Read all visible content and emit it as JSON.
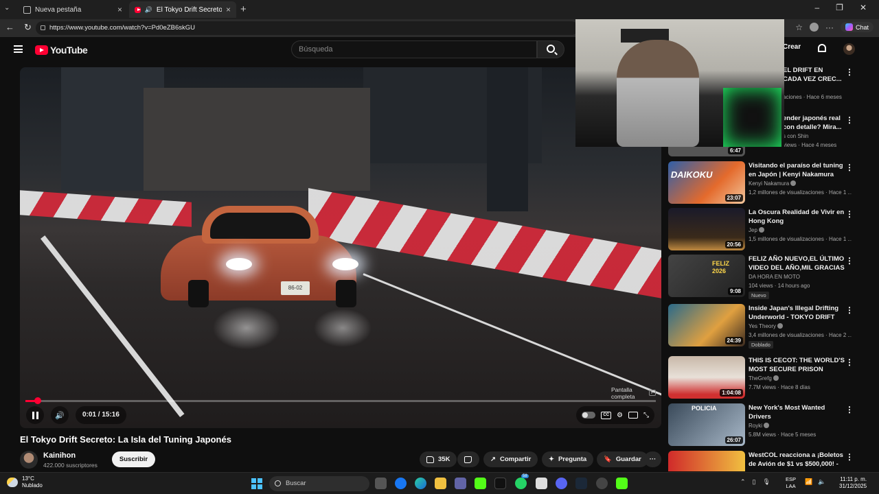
{
  "browser": {
    "tabs": [
      {
        "label": "Nueva pestaña"
      },
      {
        "label": "El Tokyo Drift Secreto: La Isla"
      }
    ],
    "url": "https://www.youtube.com/watch?v=Pd0eZB6skGU",
    "chat_label": "Chat"
  },
  "youtube": {
    "logo_text": "YouTube",
    "search_placeholder": "Búsqueda",
    "create_label": "Crear"
  },
  "player": {
    "time": "0:01 / 15:16",
    "progress_fraction": 0.0011,
    "tooltip_line1": "Pantalla",
    "tooltip_line2": "completa",
    "tooltip_key": "F",
    "plate": "86-02"
  },
  "video": {
    "title": "El Tokyo Drift Secreto: La Isla del Tuning Japonés",
    "channel": "Kainihon",
    "subscribers": "422.000 suscriptores",
    "subscribe_label": "Suscribir",
    "likes": "35K",
    "share_label": "Compartir",
    "ask_label": "Pregunta",
    "save_label": "Guardar"
  },
  "recommendations": [
    {
      "title_line1": "EL DRIFT EN",
      "title_line2": "CADA VEZ CREC...",
      "channel": "",
      "meta": "aciones · Hace 6 meses",
      "duration": "",
      "badge": ""
    },
    {
      "title_line1": "ender japonés real",
      "title_line2": "con detalle? Mira...",
      "channel": "s con Shin",
      "meta": "views · Hace 4 meses",
      "duration": "6:47",
      "badge": ""
    },
    {
      "title_line1": "Visitando el paraíso del tuning",
      "title_line2": "en Japón | Kenyi Nakamura",
      "channel": "Kenyi Nakamura",
      "meta": "1,2 millones de visualizaciones · Hace 1 ...",
      "duration": "23:07",
      "badge": ""
    },
    {
      "title_line1": "La Oscura Realidad de Vivir en",
      "title_line2": "Hong Kong",
      "channel": "Jep",
      "meta": "1,5 millones de visualizaciones · Hace 1 ...",
      "duration": "20:56",
      "badge": ""
    },
    {
      "title_line1": "FELIZ AÑO NUEVO,EL ÚLTIMO",
      "title_line2": "VIDEO DEL AÑO,MIL GRACIAS",
      "channel": "DA HORA EN MOTO",
      "meta": "104 views · 14 hours ago",
      "duration": "9:08",
      "badge": "Nuevo"
    },
    {
      "title_line1": "Inside Japan's Illegal Drifting",
      "title_line2": "Underworld - TOKYO DRIFT",
      "channel": "Yes Theory",
      "meta": "3,4 millones de visualizaciones · Hace 2 ...",
      "duration": "24:39",
      "badge": "Doblado"
    },
    {
      "title_line1": "THIS IS CECOT: THE WORLD'S",
      "title_line2": "MOST SECURE PRISON",
      "channel": "TheGrefg",
      "meta": "7.7M views · Hace 8 días",
      "duration": "1:04:08",
      "badge": ""
    },
    {
      "title_line1": "New York's Most Wanted",
      "title_line2": "Drivers",
      "channel": "Royki",
      "meta": "5.8M views · Hace 5 meses",
      "duration": "26:07",
      "badge": ""
    },
    {
      "title_line1": "WestCOL reacciona a ¡Boletos",
      "title_line2": "de Avión de $1 vs $500,000! - ...",
      "channel": "",
      "meta": "",
      "duration": "",
      "badge": ""
    }
  ],
  "thumb_texts": {
    "policia": "POLICIA",
    "daikoku": "DAIKOKU",
    "feliz": "FELIZ 2026"
  },
  "taskbar": {
    "temp": "13°C",
    "weather": "Nublado",
    "search": "Buscar",
    "lang1": "ESP",
    "lang2": "LAA",
    "time": "11:11 p. m.",
    "date": "31/12/2025",
    "badge_count": "58"
  },
  "colors": {
    "accent": "#ff0033",
    "bg": "#0f0f0f"
  }
}
